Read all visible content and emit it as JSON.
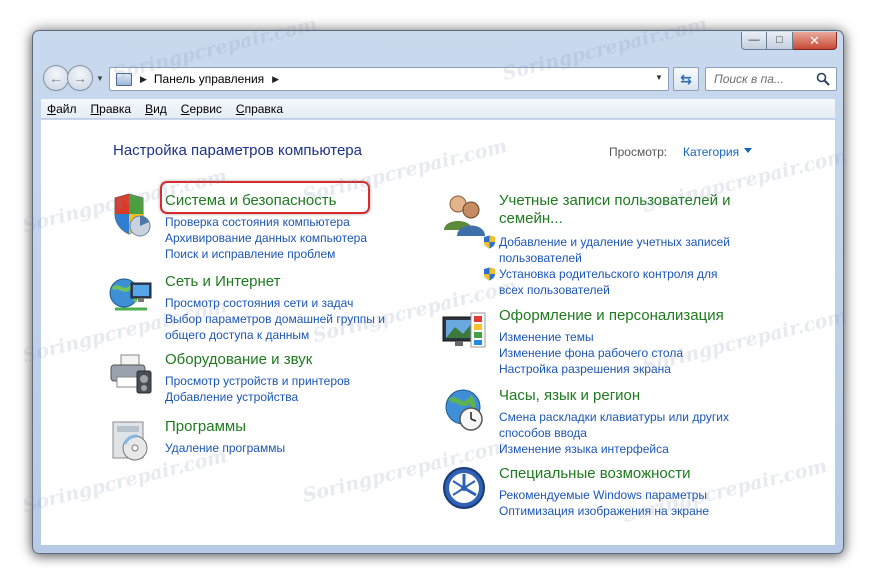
{
  "address_bar": {
    "path": [
      "Панель управления"
    ]
  },
  "search": {
    "placeholder": "Поиск в па..."
  },
  "menu": [
    "Файл",
    "Правка",
    "Вид",
    "Сервис",
    "Справка"
  ],
  "content": {
    "title": "Настройка параметров компьютера",
    "view_by_label": "Просмотр:",
    "view_by_value": "Категория",
    "left_categories": [
      {
        "title": "Система и безопасность",
        "icon": "shield-icon",
        "links": [
          "Проверка состояния компьютера",
          "Архивирование данных компьютера",
          "Поиск и исправление проблем"
        ]
      },
      {
        "title": "Сеть и Интернет",
        "icon": "network-globe-icon",
        "links": [
          "Просмотр состояния сети и задач",
          "Выбор параметров домашней группы и",
          "общего доступа к данным"
        ]
      },
      {
        "title": "Оборудование и звук",
        "icon": "printer-icon",
        "links": [
          "Просмотр устройств и принтеров",
          "Добавление устройства"
        ]
      },
      {
        "title": "Программы",
        "icon": "programs-icon",
        "links": [
          "Удаление программы"
        ]
      }
    ],
    "right_categories": [
      {
        "title_line1": "Учетные записи пользователей и",
        "title_line2": "семейн...",
        "icon": "users-icon",
        "links": [
          "Добавление и удаление учетных записей",
          "пользователей",
          "Установка родительского контроля для",
          "всех пользователей"
        ]
      },
      {
        "title": "Оформление и персонализация",
        "icon": "monitor-palette-icon",
        "links": [
          "Изменение темы",
          "Изменение фона рабочего стола",
          "Настройка разрешения экрана"
        ]
      },
      {
        "title": "Часы, язык и регион",
        "icon": "clock-globe-icon",
        "links": [
          "Смена раскладки клавиатуры или других",
          "способов ввода",
          "Изменение языка интерфейса"
        ]
      },
      {
        "title": "Специальные возможности",
        "icon": "accessibility-icon",
        "links": [
          "Рекомендуемые Windows параметры",
          "Оптимизация изображения на экране"
        ]
      }
    ]
  },
  "watermark": "Soringpcrepair.com"
}
